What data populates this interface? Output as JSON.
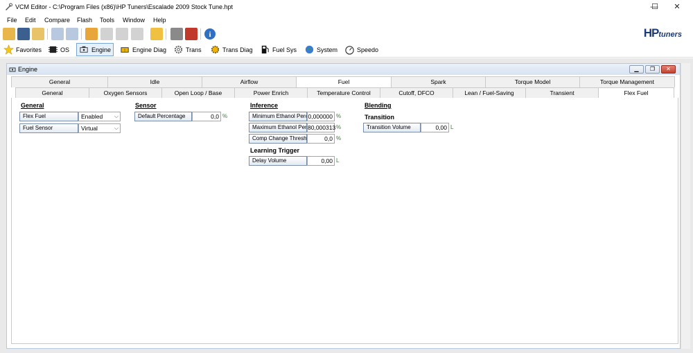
{
  "window": {
    "title": "VCM Editor - C:\\Program Files (x86)\\HP Tuners\\Escalade 2009 Stock Tune.hpt",
    "minimize": "—",
    "maximize": "☐",
    "close": "✕"
  },
  "menu": [
    "File",
    "Edit",
    "Compare",
    "Flash",
    "Tools",
    "Window",
    "Help"
  ],
  "logo": {
    "main": "HP",
    "sub": "tuners"
  },
  "nav": {
    "favorites": "Favorites",
    "os": "OS",
    "engine": "Engine",
    "engine_diag": "Engine Diag",
    "trans": "Trans",
    "trans_diag": "Trans Diag",
    "fuel_sys": "Fuel Sys",
    "system": "System",
    "speedo": "Speedo"
  },
  "child": {
    "title": "Engine",
    "min": "▁",
    "restore": "❐",
    "close": "✕"
  },
  "tabs_top": [
    "General",
    "Idle",
    "Airflow",
    "Fuel",
    "Spark",
    "Torque Model",
    "Torque Management"
  ],
  "tabs_sub": [
    "General",
    "Oxygen Sensors",
    "Open Loop / Base",
    "Power Enrich",
    "Temperature Control",
    "Cutoff, DFCO",
    "Lean / Fuel-Saving",
    "Transient",
    "Flex Fuel"
  ],
  "general": {
    "heading": "General",
    "flex_fuel_label": "Flex Fuel",
    "flex_fuel_value": "Enabled",
    "fuel_sensor_label": "Fuel Sensor",
    "fuel_sensor_value": "Virtual"
  },
  "sensor": {
    "heading": "Sensor",
    "default_pct_label": "Default Percentage",
    "default_pct_value": "0,0",
    "default_pct_unit": "%"
  },
  "inference": {
    "heading": "Inference",
    "min_label": "Minimum Ethanol Percer",
    "min_value": "0,000000",
    "min_unit": "%",
    "max_label": "Maximum Ethanol Perce",
    "max_value": "80,000313",
    "max_unit": "%",
    "comp_label": "Comp Change Thresh",
    "comp_value": "0,0",
    "comp_unit": "%"
  },
  "learning": {
    "heading": "Learning Trigger",
    "delay_label": "Delay Volume",
    "delay_value": "0,00",
    "delay_unit": "L"
  },
  "blending": {
    "heading": "Blending",
    "sub": "Transition",
    "tv_label": "Transition Volume",
    "tv_value": "0,00",
    "tv_unit": "L"
  }
}
